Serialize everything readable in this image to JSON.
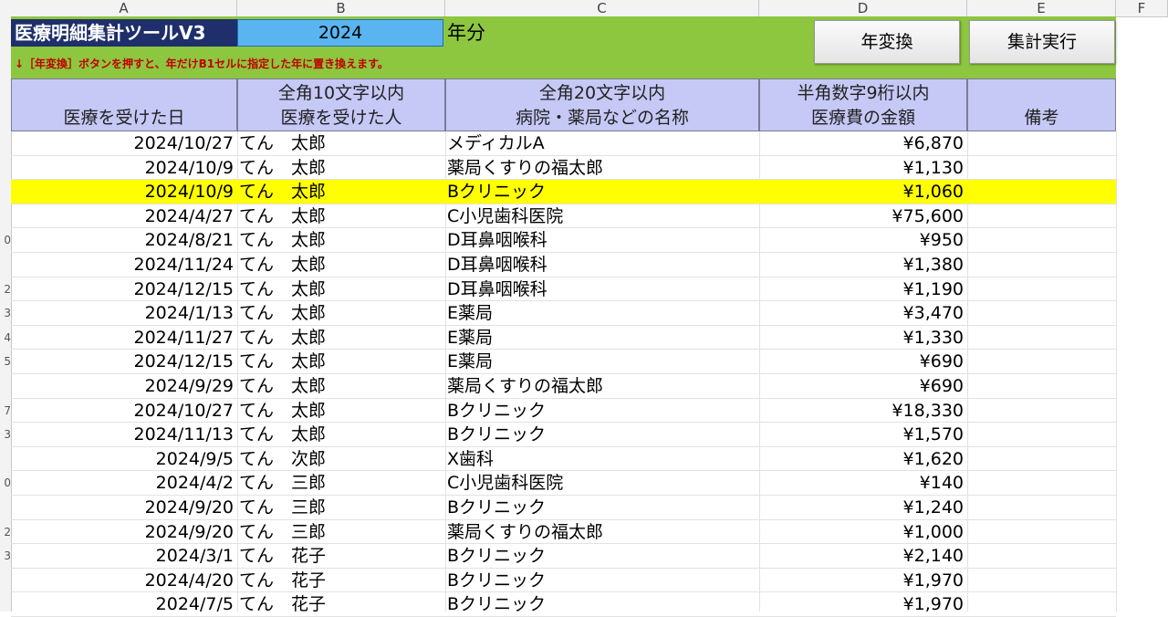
{
  "columns": [
    "A",
    "B",
    "C",
    "D",
    "E",
    "F"
  ],
  "row_numbers": [
    "",
    "",
    "",
    "",
    "0",
    "",
    "2",
    "3",
    "4",
    "5",
    "",
    "7",
    "3",
    "",
    "0",
    "",
    "2",
    "3",
    ""
  ],
  "header": {
    "title": "医療明細集計ツールV3",
    "year_value": "2024",
    "year_suffix": "年分",
    "note": "↓［年変換］ボタンを押すと、年だけB1セルに指定した年に置き換えます。",
    "btn_convert": "年変換",
    "btn_run": "集計実行"
  },
  "table_header": {
    "date": {
      "l1": "",
      "l2": "医療を受けた日"
    },
    "name": {
      "l1": "全角10文字以内",
      "l2": "医療を受けた人"
    },
    "place": {
      "l1": "全角20文字以内",
      "l2": "病院・薬局などの名称"
    },
    "amount": {
      "l1": "半角数字9桁以内",
      "l2": "医療費の金額"
    },
    "note": {
      "l1": "",
      "l2": "備考"
    }
  },
  "rows": [
    {
      "date": "2024/10/27",
      "name": "てん　太郎",
      "place": "メディカルA",
      "amount": "¥6,870",
      "note": ""
    },
    {
      "date": "2024/10/9",
      "name": "てん　太郎",
      "place": "薬局くすりの福太郎",
      "amount": "¥1,130",
      "note": ""
    },
    {
      "date": "2024/10/9",
      "name": "てん　太郎",
      "place": "Bクリニック",
      "amount": "¥1,060",
      "note": ""
    },
    {
      "date": "2024/4/27",
      "name": "てん　太郎",
      "place": "C小児歯科医院",
      "amount": "¥75,600",
      "note": ""
    },
    {
      "date": "2024/8/21",
      "name": "てん　太郎",
      "place": "D耳鼻咽喉科",
      "amount": "¥950",
      "note": ""
    },
    {
      "date": "2024/11/24",
      "name": "てん　太郎",
      "place": "D耳鼻咽喉科",
      "amount": "¥1,380",
      "note": ""
    },
    {
      "date": "2024/12/15",
      "name": "てん　太郎",
      "place": "D耳鼻咽喉科",
      "amount": "¥1,190",
      "note": ""
    },
    {
      "date": "2024/1/13",
      "name": "てん　太郎",
      "place": "E薬局",
      "amount": "¥3,470",
      "note": ""
    },
    {
      "date": "2024/11/27",
      "name": "てん　太郎",
      "place": "E薬局",
      "amount": "¥1,330",
      "note": ""
    },
    {
      "date": "2024/12/15",
      "name": "てん　太郎",
      "place": "E薬局",
      "amount": "¥690",
      "note": ""
    },
    {
      "date": "2024/9/29",
      "name": "てん　太郎",
      "place": "薬局くすりの福太郎",
      "amount": "¥690",
      "note": ""
    },
    {
      "date": "2024/10/27",
      "name": "てん　太郎",
      "place": "Bクリニック",
      "amount": "¥18,330",
      "note": ""
    },
    {
      "date": "2024/11/13",
      "name": "てん　太郎",
      "place": "Bクリニック",
      "amount": "¥1,570",
      "note": ""
    },
    {
      "date": "2024/9/5",
      "name": "てん　次郎",
      "place": "X歯科",
      "amount": "¥1,620",
      "note": ""
    },
    {
      "date": "2024/4/2",
      "name": "てん　三郎",
      "place": "C小児歯科医院",
      "amount": "¥140",
      "note": ""
    },
    {
      "date": "2024/9/20",
      "name": "てん　三郎",
      "place": "Bクリニック",
      "amount": "¥1,240",
      "note": ""
    },
    {
      "date": "2024/9/20",
      "name": "てん　三郎",
      "place": "薬局くすりの福太郎",
      "amount": "¥1,000",
      "note": ""
    },
    {
      "date": "2024/3/1",
      "name": "てん　花子",
      "place": "Bクリニック",
      "amount": "¥2,140",
      "note": ""
    },
    {
      "date": "2024/4/20",
      "name": "てん　花子",
      "place": "Bクリニック",
      "amount": "¥1,970",
      "note": ""
    },
    {
      "date": "2024/7/5",
      "name": "てん　花子",
      "place": "Bクリニック",
      "amount": "¥1,970",
      "note": ""
    }
  ],
  "highlight_row_index": 2,
  "colors": {
    "highlight": "#ffff00",
    "header_band": "#8dc63f",
    "title_bg": "#1f2f6b",
    "year_bg": "#5ab4f0",
    "table_header_bg": "#c6c8f6",
    "note_text": "#c00000"
  }
}
